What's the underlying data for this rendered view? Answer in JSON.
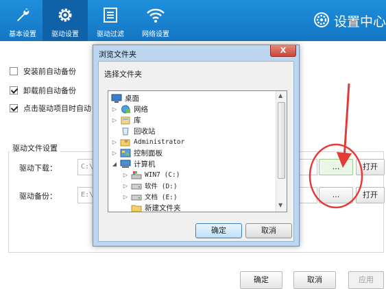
{
  "topnav": {
    "tabs": [
      {
        "label": "基本设置",
        "icon": "wrench-icon"
      },
      {
        "label": "驱动设置",
        "icon": "gear-icon",
        "active": true
      },
      {
        "label": "驱动过滤",
        "icon": "list-icon"
      },
      {
        "label": "网络设置",
        "icon": "wifi-icon"
      }
    ],
    "brand_label": "设置中心",
    "brand_icon": "gear-icon"
  },
  "options": [
    {
      "label": "安装前自动备份",
      "checked": false
    },
    {
      "label": "卸载前自动备份",
      "checked": true
    },
    {
      "label": "点击驱动项目时自动",
      "checked": true
    }
  ],
  "driver_files": {
    "title": "驱动文件设置",
    "download": {
      "label": "驱动下载：",
      "path": "C:\\",
      "browse": "...",
      "open": "打开"
    },
    "backup": {
      "label": "驱动备份：",
      "path": "E:\\",
      "browse": "...",
      "open": "打开"
    }
  },
  "footer": {
    "ok": "确定",
    "cancel": "取消",
    "apply": "应用"
  },
  "dialog": {
    "title": "浏览文件夹",
    "close": "X",
    "prompt": "选择文件夹",
    "tree": [
      {
        "label": "桌面",
        "icon": "desktop-icon"
      },
      {
        "label": "网络",
        "icon": "network-icon"
      },
      {
        "label": "库",
        "icon": "library-icon"
      },
      {
        "label": "回收站",
        "icon": "recycle-bin-icon"
      },
      {
        "label": "Administrator",
        "icon": "user-folder-icon"
      },
      {
        "label": "控制面板",
        "icon": "control-panel-icon"
      },
      {
        "label": "计算机",
        "icon": "computer-icon"
      },
      {
        "label": "WIN7 (C:)",
        "icon": "system-drive-icon"
      },
      {
        "label": "软件 (D:)",
        "icon": "drive-icon"
      },
      {
        "label": "文档 (E:)",
        "icon": "drive-icon"
      },
      {
        "label": "新建文件夹",
        "icon": "folder-icon"
      }
    ],
    "ok": "确定",
    "cancel": "取消"
  },
  "colors": {
    "topbar": "#1a84d2",
    "active_tab": "#0f62a8",
    "annotation": "#e53935"
  }
}
